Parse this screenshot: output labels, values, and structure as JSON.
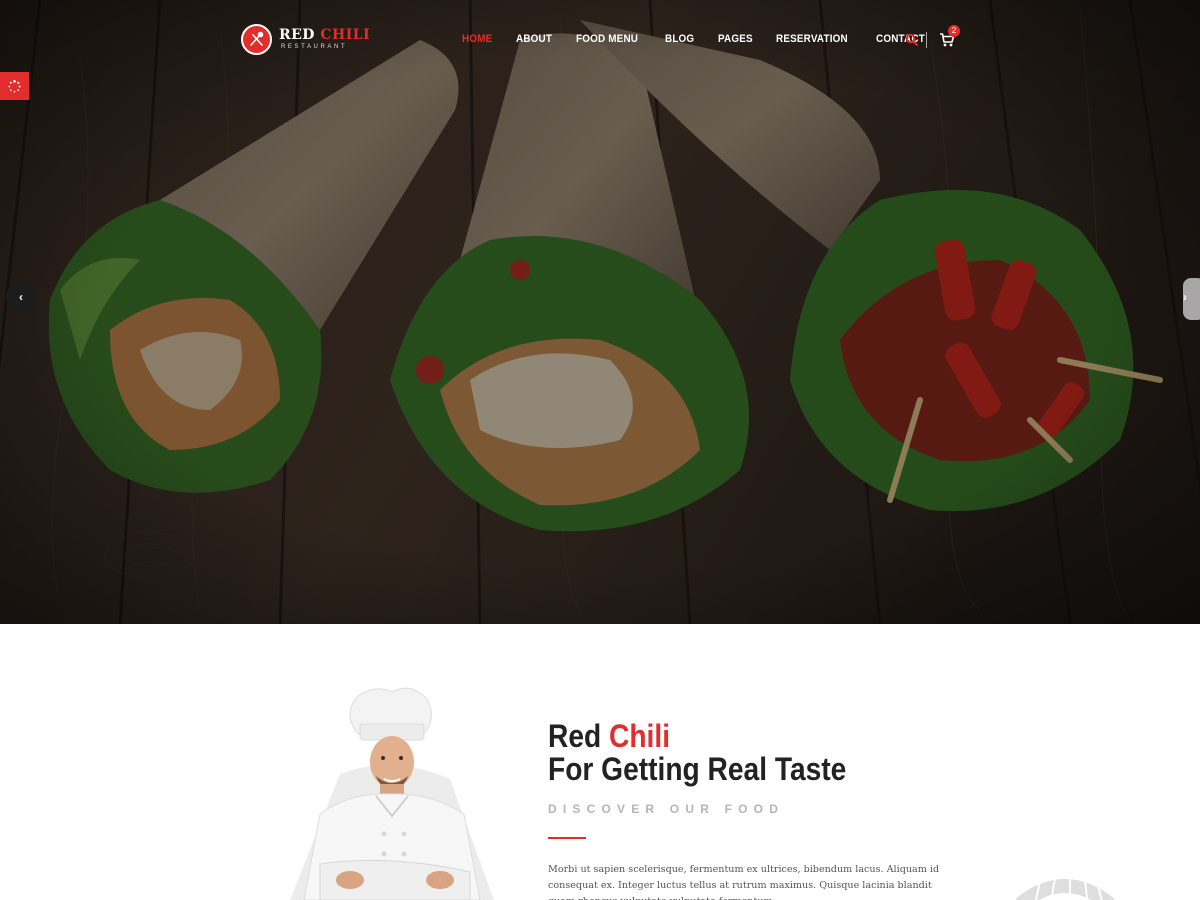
{
  "brand": {
    "name_part1": "RED ",
    "name_part2": "CHILI",
    "tagline": "RESTAURANT",
    "accent_color": "#e32c2c"
  },
  "nav": {
    "items": [
      {
        "label": "HOME",
        "active": true
      },
      {
        "label": "ABOUT",
        "active": false
      },
      {
        "label": "FOOD MENU",
        "active": false
      },
      {
        "label": "BLOG",
        "active": false
      },
      {
        "label": "PAGES",
        "active": false
      },
      {
        "label": "RESERVATION",
        "active": false
      },
      {
        "label": "CONTACT",
        "active": false
      }
    ],
    "search_icon": "search-icon",
    "cart_icon": "cart-icon",
    "cart_count": "2"
  },
  "hero": {
    "prev_glyph": "‹",
    "next_glyph": "›"
  },
  "about": {
    "title_part1": "Red ",
    "title_part2": "Chili",
    "title_line2": "For Getting Real Taste",
    "subtitle": "DISCOVER OUR FOOD",
    "body": "Morbi ut sapien scelerisque, fermentum ex ultrices, bibendum lacus. Aliquam id consequat ex. Integer luctus tellus at rutrum maximus. Quisque lacinia blandit quam rhoncus vulputate vulputate fermentum."
  }
}
